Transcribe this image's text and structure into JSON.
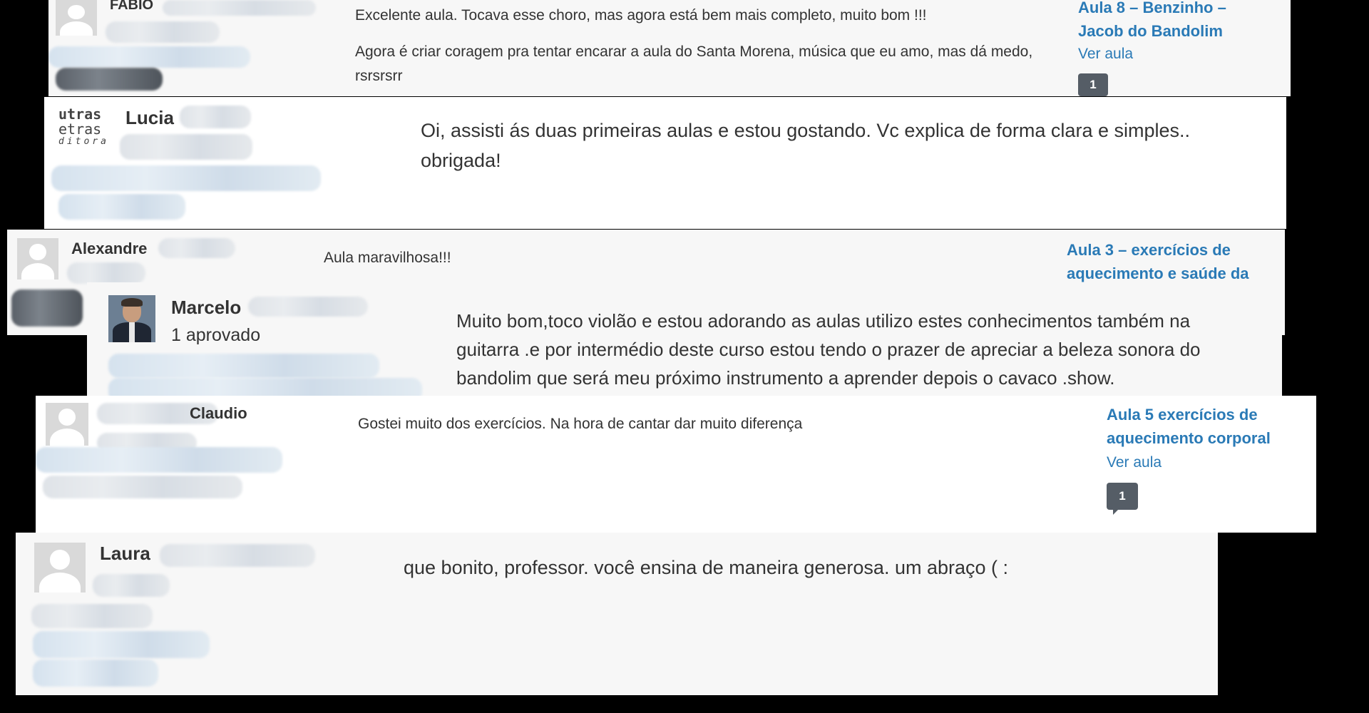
{
  "comments": [
    {
      "author": "FABIO",
      "paragraphs": [
        "Excelente aula. Tocava esse choro, mas agora está bem mais completo, muito bom !!!",
        "Agora é criar coragem pra tentar encarar a aula do Santa Morena, música que eu amo, mas dá medo, rsrsrsrr"
      ],
      "lesson_title": "Aula 8 – Benzinho – Jacob do Bandolim",
      "view_link": "Ver aula",
      "count": "1"
    },
    {
      "author": "Lucia",
      "logo_lines": [
        "utras",
        "etras",
        "ditora"
      ],
      "paragraphs": [
        "Oi, assisti ás duas primeiras aulas e estou gostando. Vc explica de forma clara e simples.. obrigada!"
      ]
    },
    {
      "author": "Alexandre",
      "paragraphs": [
        "Aula maravilhosa!!!"
      ],
      "lesson_title": "Aula 3 – exercícios de aquecimento e saúde da"
    },
    {
      "author": "Marcelo",
      "status": "1 aprovado",
      "paragraphs": [
        "Muito bom,toco violão e estou adorando as aulas utilizo estes conhecimentos também na guitarra .e por intermédio deste curso estou tendo o prazer de apreciar a beleza sonora do bandolim que será meu próximo instrumento a aprender depois o cavaco .show."
      ]
    },
    {
      "author": "Claudio",
      "paragraphs": [
        "Gostei muito dos exercícios. Na hora de cantar dar muito diferença"
      ],
      "lesson_title": "Aula 5 exercícios de aquecimento corporal",
      "view_link": "Ver aula",
      "count": "1"
    },
    {
      "author": "Laura",
      "paragraphs": [
        "que bonito, professor. você ensina de maneira generosa. um abraço ( :"
      ]
    }
  ],
  "colors": {
    "background": "#000000",
    "card_light": "#f7f7f7",
    "card_white": "#ffffff",
    "link": "#2a7ab6",
    "text": "#333333",
    "badge": "#555d66"
  },
  "icons": [
    "default-avatar-icon",
    "user-photo",
    "publisher-logo",
    "comment-count-badge"
  ]
}
